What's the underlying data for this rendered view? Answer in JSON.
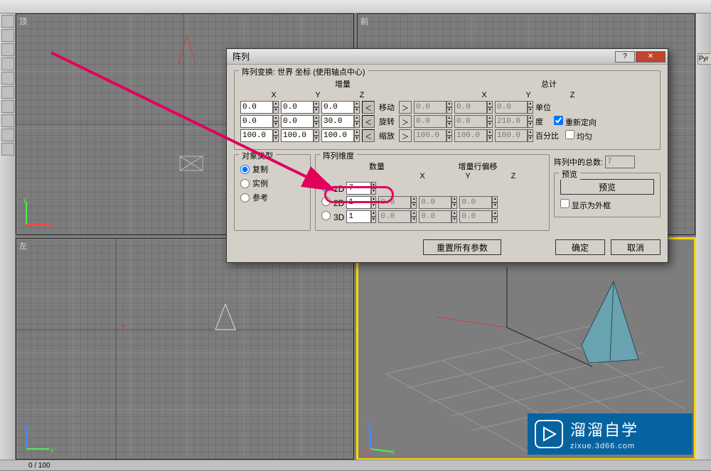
{
  "viewports": {
    "top_label": "顶",
    "front_label": "前",
    "left_label": "左",
    "persp_label": ""
  },
  "status": {
    "text": "0 / 100"
  },
  "right_panel": {
    "object_hint": "Pyr"
  },
  "dialog": {
    "title": "阵列",
    "transform": {
      "legend": "阵列变换:  世界 坐标 (使用轴点中心)",
      "inc_label": "增量",
      "total_label": "总计",
      "x_label": "X",
      "y_label": "Y",
      "z_label": "Z",
      "move_label": "移动",
      "rotate_label": "旋转",
      "scale_label": "缩放",
      "units_label": "单位",
      "deg_label": "度",
      "percent_label": "百分比",
      "reorient_label": "重新定向",
      "uniform_label": "均匀",
      "move": {
        "ix": "0.0",
        "iy": "0.0",
        "iz": "0.0",
        "tx": "0.0",
        "ty": "0.0",
        "tz": "0.0"
      },
      "rotate": {
        "ix": "0.0",
        "iy": "0.0",
        "iz": "30.0",
        "tx": "0.0",
        "ty": "0.0",
        "tz": "210.0"
      },
      "scale": {
        "ix": "100.0",
        "iy": "100.0",
        "iz": "100.0",
        "tx": "100.0",
        "ty": "100.0",
        "tz": "100.0"
      }
    },
    "object_type": {
      "legend": "对象类型",
      "copy": "复制",
      "instance": "实例",
      "reference": "参考"
    },
    "dimension": {
      "legend": "阵列维度",
      "count_label": "数量",
      "offset_label": "增量行偏移",
      "x_label": "X",
      "y_label": "Y",
      "z_label": "Z",
      "d1_label": "1D",
      "d2_label": "2D",
      "d3_label": "3D",
      "d1_count": "7",
      "d2_count": "1",
      "d3_count": "1",
      "d2_x": "0.0",
      "d2_y": "0.0",
      "d2_z": "0.0",
      "d3_x": "0.0",
      "d3_y": "0.0",
      "d3_z": "0.0"
    },
    "total_in_array_label": "阵列中的总数:",
    "total_in_array": "7",
    "preview": {
      "legend": "预览",
      "button": "预览",
      "wire_label": "显示为外框"
    },
    "reset_button": "重置所有参数",
    "ok_button": "确定",
    "cancel_button": "取消"
  },
  "watermark": {
    "brand": "溜溜自学",
    "sub": "zixue.3d66.com"
  }
}
